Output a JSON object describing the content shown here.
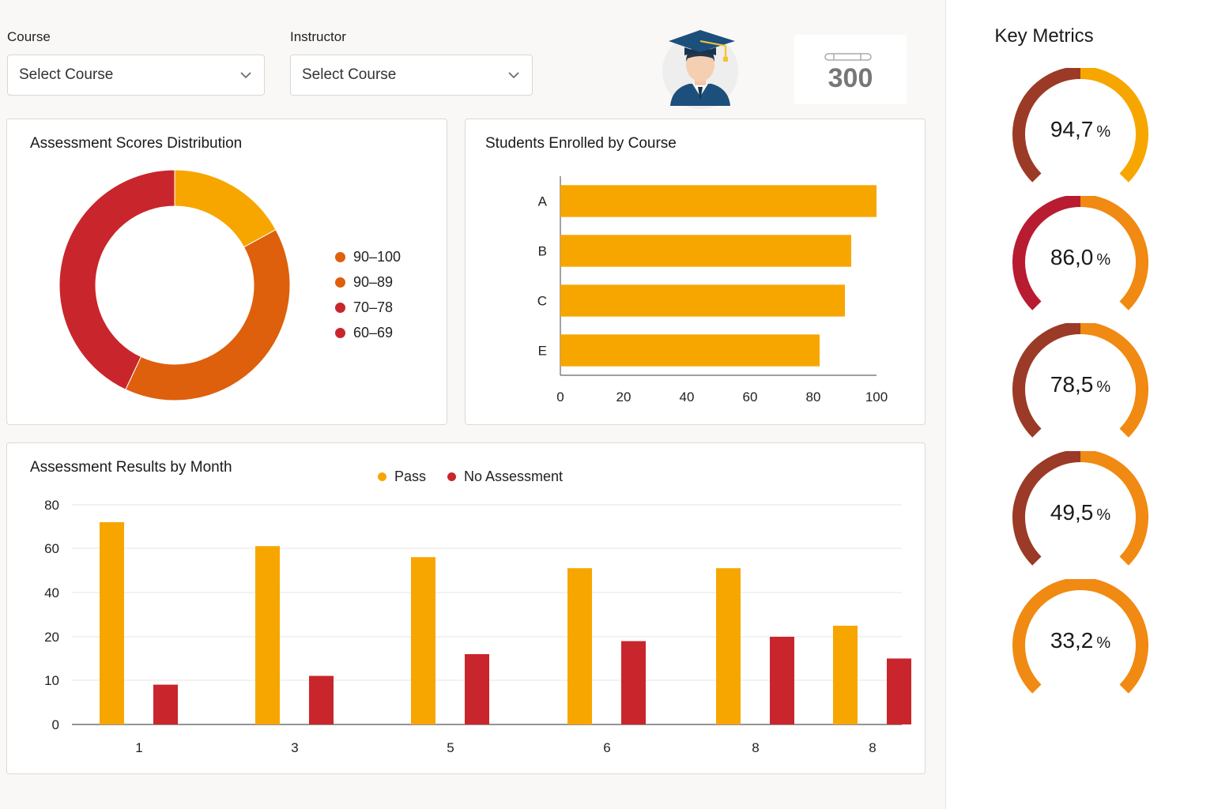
{
  "filters": {
    "course": {
      "label": "Course",
      "value": "Select Course"
    },
    "instructor": {
      "label": "Instructor",
      "value": "Select Course"
    }
  },
  "summary": {
    "count": "300",
    "icon": "graduate-avatar-icon"
  },
  "colors": {
    "gold": "#f7a600",
    "orange": "#de5f0c",
    "red": "#c8262c",
    "gauge_orange": "#f08a12",
    "gauge_brown": "#9b3a26",
    "gauge_crimson": "#b81c30"
  },
  "donut": {
    "title": "Assessment Scores Distribution",
    "legend": [
      {
        "label": "90–100",
        "color": "#de5f0c"
      },
      {
        "label": "90–89",
        "color": "#de5f0c"
      },
      {
        "label": "70–78",
        "color": "#c8262c"
      },
      {
        "label": "60–69",
        "color": "#c8262c"
      }
    ]
  },
  "enrolled": {
    "title": "Students Enrolled by Course"
  },
  "monthly": {
    "title": "Assessment Results by Month",
    "legend": [
      {
        "label": "Pass",
        "color": "#f7a600"
      },
      {
        "label": "No Assessment",
        "color": "#c8262c"
      }
    ]
  },
  "chart_data": [
    {
      "type": "pie",
      "title": "Assessment Scores Distribution",
      "slices": [
        {
          "value": 17,
          "color": "#f7a600"
        },
        {
          "value": 40,
          "color": "#de5f0c"
        },
        {
          "value": 43,
          "color": "#c8262c"
        }
      ]
    },
    {
      "type": "bar",
      "orientation": "horizontal",
      "title": "Students Enrolled by Course",
      "categories": [
        "A",
        "B",
        "C",
        "E"
      ],
      "values": [
        100,
        92,
        90,
        82
      ],
      "xlim": [
        0,
        100
      ],
      "xticks": [
        0,
        20,
        40,
        60,
        80,
        100
      ],
      "color": "#f7a600"
    },
    {
      "type": "bar",
      "title": "Assessment Results by Month",
      "categories": [
        "1",
        "3",
        "5",
        "6",
        "8",
        "8"
      ],
      "yticks": [
        0,
        10,
        20,
        40,
        60,
        80
      ],
      "grid": true,
      "legend": "top",
      "series": [
        {
          "name": "Pass",
          "values": [
            72,
            61,
            56,
            51,
            51,
            25
          ],
          "color": "#f7a600"
        },
        {
          "name": "No Assessment",
          "values": [
            9,
            11,
            16,
            19,
            20,
            15
          ],
          "color": "#c8262c"
        }
      ]
    }
  ],
  "metrics": {
    "title": "Key Metrics",
    "items": [
      {
        "value": "94,7",
        "unit": "%",
        "pct": 94.7,
        "left": "#9b3a26",
        "right": "#f7a600"
      },
      {
        "value": "86,0",
        "unit": "%",
        "pct": 86.0,
        "left": "#b81c30",
        "right": "#f08a12"
      },
      {
        "value": "78,5",
        "unit": "%",
        "pct": 78.5,
        "left": "#9b3a26",
        "right": "#f08a12"
      },
      {
        "value": "49,5",
        "unit": "%",
        "pct": 49.5,
        "left": "#9b3a26",
        "right": "#f08a12"
      },
      {
        "value": "33,2",
        "unit": "%",
        "pct": 33.2,
        "left": "#f08a12",
        "right": "#f08a12"
      }
    ]
  }
}
